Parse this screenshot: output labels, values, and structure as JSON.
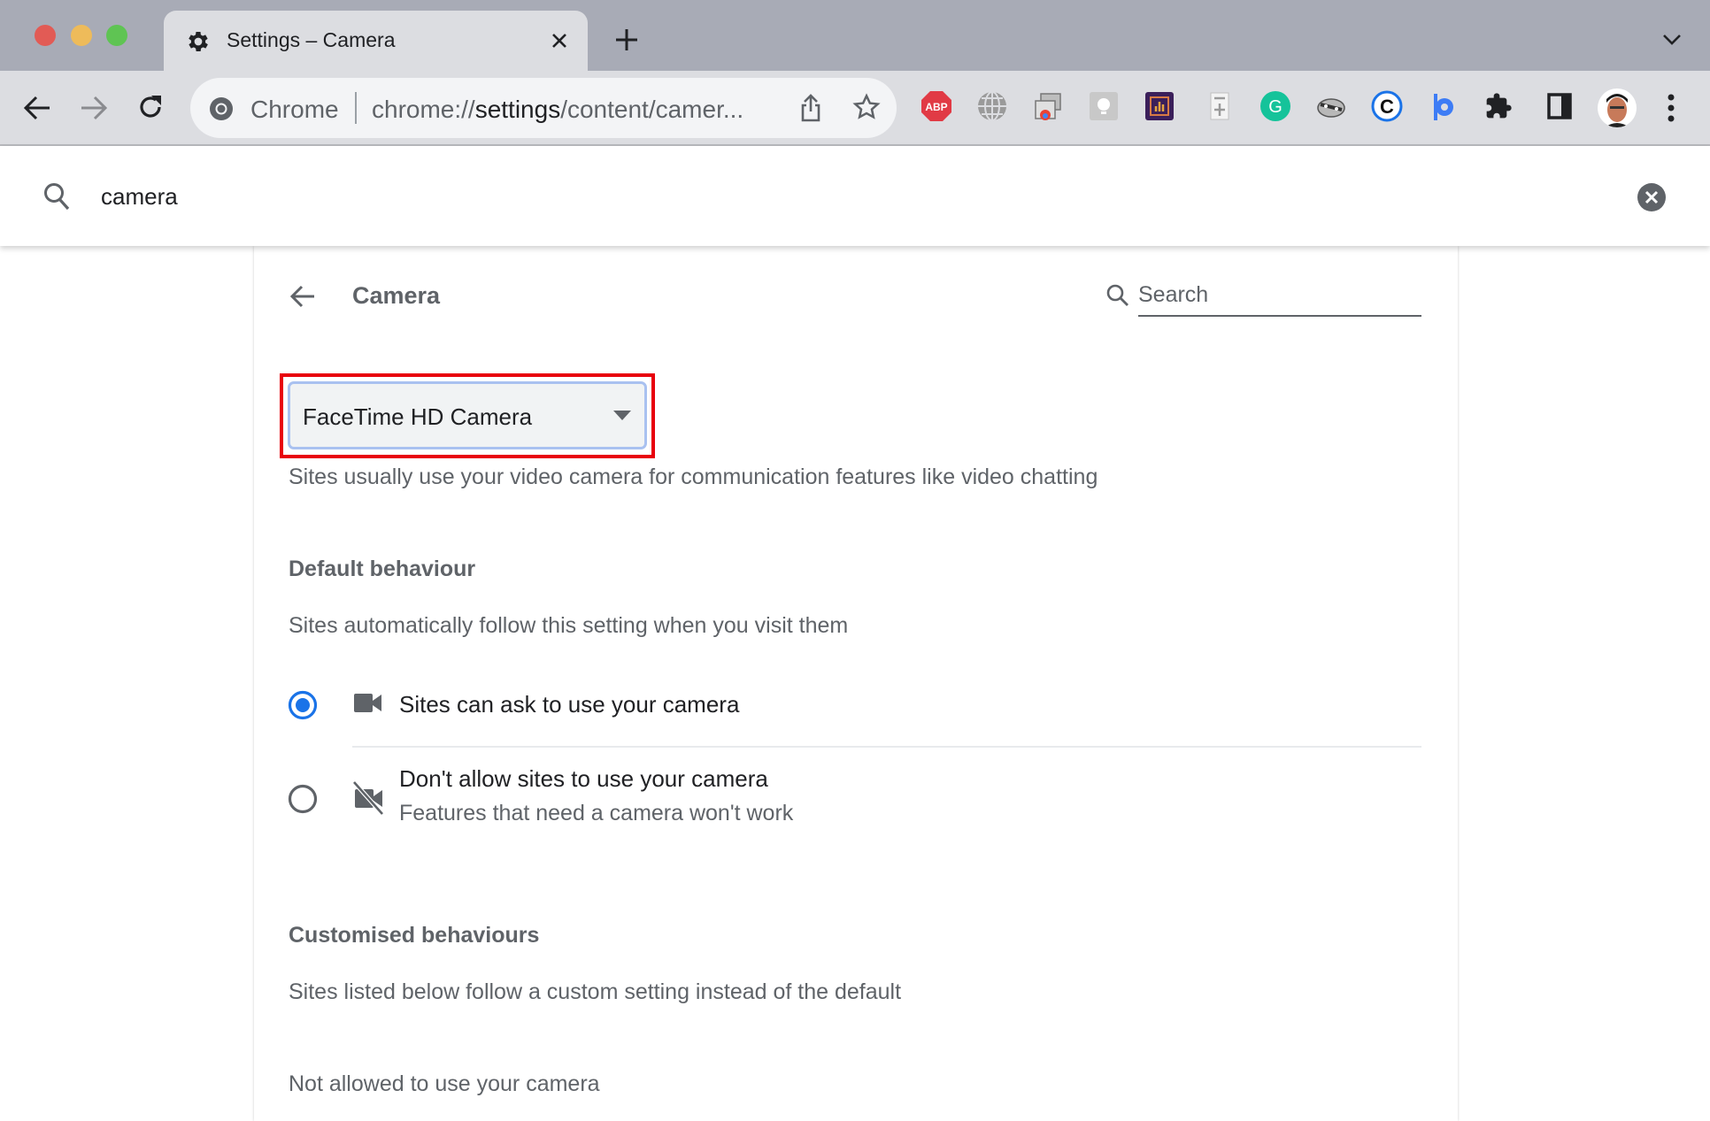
{
  "browser": {
    "tab": {
      "title": "Settings – Camera",
      "icon": "gear-icon"
    },
    "omnibox": {
      "site_label": "Chrome",
      "url_prefix": "chrome://",
      "url_host": "settings",
      "url_rest": "/content/camer..."
    },
    "extensions": [
      {
        "name": "adblock-plus-icon",
        "label": "ABP"
      },
      {
        "name": "globe-icon"
      },
      {
        "name": "chrome-remote-desktop-icon"
      },
      {
        "name": "lightbulb-icon"
      },
      {
        "name": "analytics-icon"
      },
      {
        "name": "document-add-icon"
      },
      {
        "name": "grammarly-icon",
        "label": "G"
      },
      {
        "name": "raccoon-icon"
      },
      {
        "name": "copyright-c-icon",
        "label": "C"
      },
      {
        "name": "pocket-p-icon",
        "label": "p"
      },
      {
        "name": "extensions-puzzle-icon"
      },
      {
        "name": "side-panel-icon"
      }
    ]
  },
  "settings_search": {
    "value": "camera"
  },
  "page": {
    "title": "Camera",
    "search_placeholder": "Search",
    "camera_select": {
      "selected": "FaceTime HD Camera"
    },
    "description": "Sites usually use your video camera for communication features like video chatting",
    "default_behaviour": {
      "heading": "Default behaviour",
      "subtext": "Sites automatically follow this setting when you visit them",
      "options": [
        {
          "label": "Sites can ask to use your camera",
          "sublabel": "",
          "selected": true,
          "icon": "videocam-icon"
        },
        {
          "label": "Don't allow sites to use your camera",
          "sublabel": "Features that need a camera won't work",
          "selected": false,
          "icon": "videocam-off-icon"
        }
      ]
    },
    "customised_behaviours": {
      "heading": "Customised behaviours",
      "subtext": "Sites listed below follow a custom setting instead of the default",
      "not_allowed_heading": "Not allowed to use your camera"
    }
  },
  "colors": {
    "accent": "#1a73e8",
    "highlight_box": "#e8000b",
    "tabstrip": "#a8abb6",
    "toolbar": "#dcdde1"
  }
}
